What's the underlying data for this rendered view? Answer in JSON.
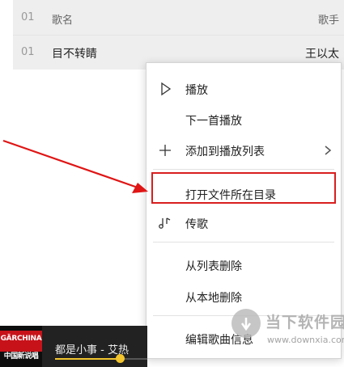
{
  "song_list": {
    "header": {
      "num": "01",
      "name": "歌名",
      "singer": "歌手"
    },
    "rows": [
      {
        "num": "01",
        "name": "目不转睛",
        "singer": "王以太"
      }
    ]
  },
  "context_menu": {
    "items": [
      {
        "label": "播放",
        "icon": "play-icon"
      },
      {
        "label": "下一首播放",
        "icon": ""
      },
      {
        "label": "添加到播放列表",
        "icon": "plus-icon",
        "submenu": true
      },
      {
        "label": "打开文件所在目录",
        "icon": "",
        "highlighted": true
      },
      {
        "label": "传歌",
        "icon": "music-note-transfer-icon"
      },
      {
        "label": "从列表删除",
        "icon": ""
      },
      {
        "label": "从本地删除",
        "icon": ""
      },
      {
        "label": "编辑歌曲信息",
        "icon": ""
      }
    ]
  },
  "player": {
    "album_text_line1": "GÄRCHINA",
    "album_text_line2": "中国新说唱",
    "now_playing": "都是小事 - 艾热",
    "progress_fraction": 0.7
  },
  "watermark": {
    "title": "当下软件园",
    "url": "www.downxia.com"
  },
  "colors": {
    "highlight_border": "#d91e1e",
    "annotation_arrow": "#e01515",
    "progress_accent": "#f3c52e",
    "list_background": "#eeeeee"
  }
}
